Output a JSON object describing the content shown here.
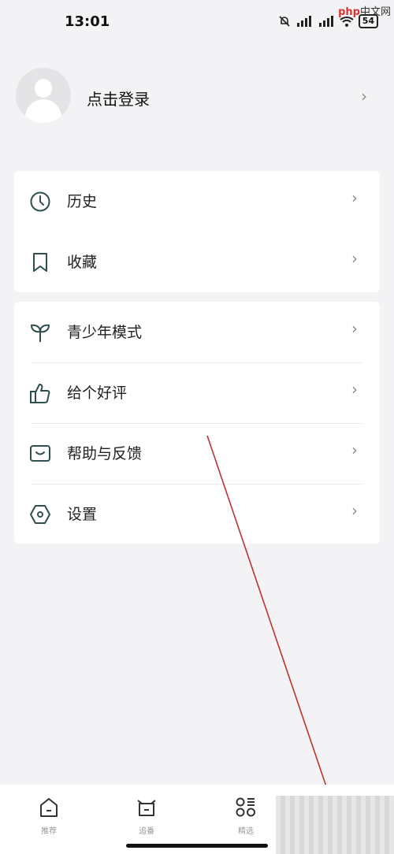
{
  "status_bar": {
    "time": "13:01",
    "battery": "54",
    "watermark_php": "php",
    "watermark_cn": "中文网"
  },
  "profile": {
    "login_label": "点击登录"
  },
  "menu_group_1": [
    {
      "label": "历史",
      "icon": "clock-icon"
    },
    {
      "label": "收藏",
      "icon": "bookmark-icon"
    }
  ],
  "menu_group_2": [
    {
      "label": "青少年模式",
      "icon": "sprout-icon"
    },
    {
      "label": "给个好评",
      "icon": "thumbs-up-icon"
    },
    {
      "label": "帮助与反馈",
      "icon": "feedback-icon"
    },
    {
      "label": "设置",
      "icon": "settings-icon"
    }
  ],
  "bottom_nav": [
    {
      "label": "推荐",
      "icon": "home-icon"
    },
    {
      "label": "追番",
      "icon": "tv-basket-icon"
    },
    {
      "label": "精选",
      "icon": "grid-icon"
    }
  ],
  "colors": {
    "icon_stroke": "#2f4f4f",
    "chevron": "#8a8a8a",
    "background": "#f3f3f5"
  }
}
